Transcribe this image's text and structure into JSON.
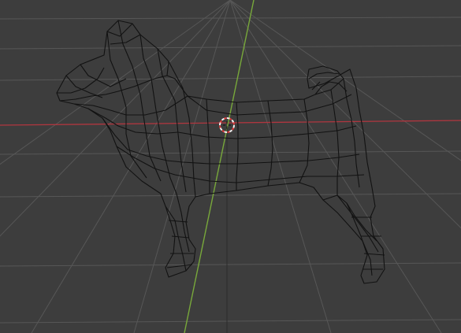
{
  "viewport": {
    "view_type": "3d-viewport",
    "shading_mode": "wireframe",
    "object_shown": "dog-mesh",
    "object_selected": false,
    "show_grid_floor": true,
    "show_x_axis": true,
    "show_y_axis": true,
    "show_3d_cursor": true
  },
  "colors": {
    "background": "#3d3d3d",
    "grid_line": "#575757",
    "x_axis": "#b0363f",
    "y_axis": "#78a83b",
    "wireframe": "#121212",
    "cursor_red": "#e03a3a",
    "cursor_white": "#f2f2f2"
  }
}
